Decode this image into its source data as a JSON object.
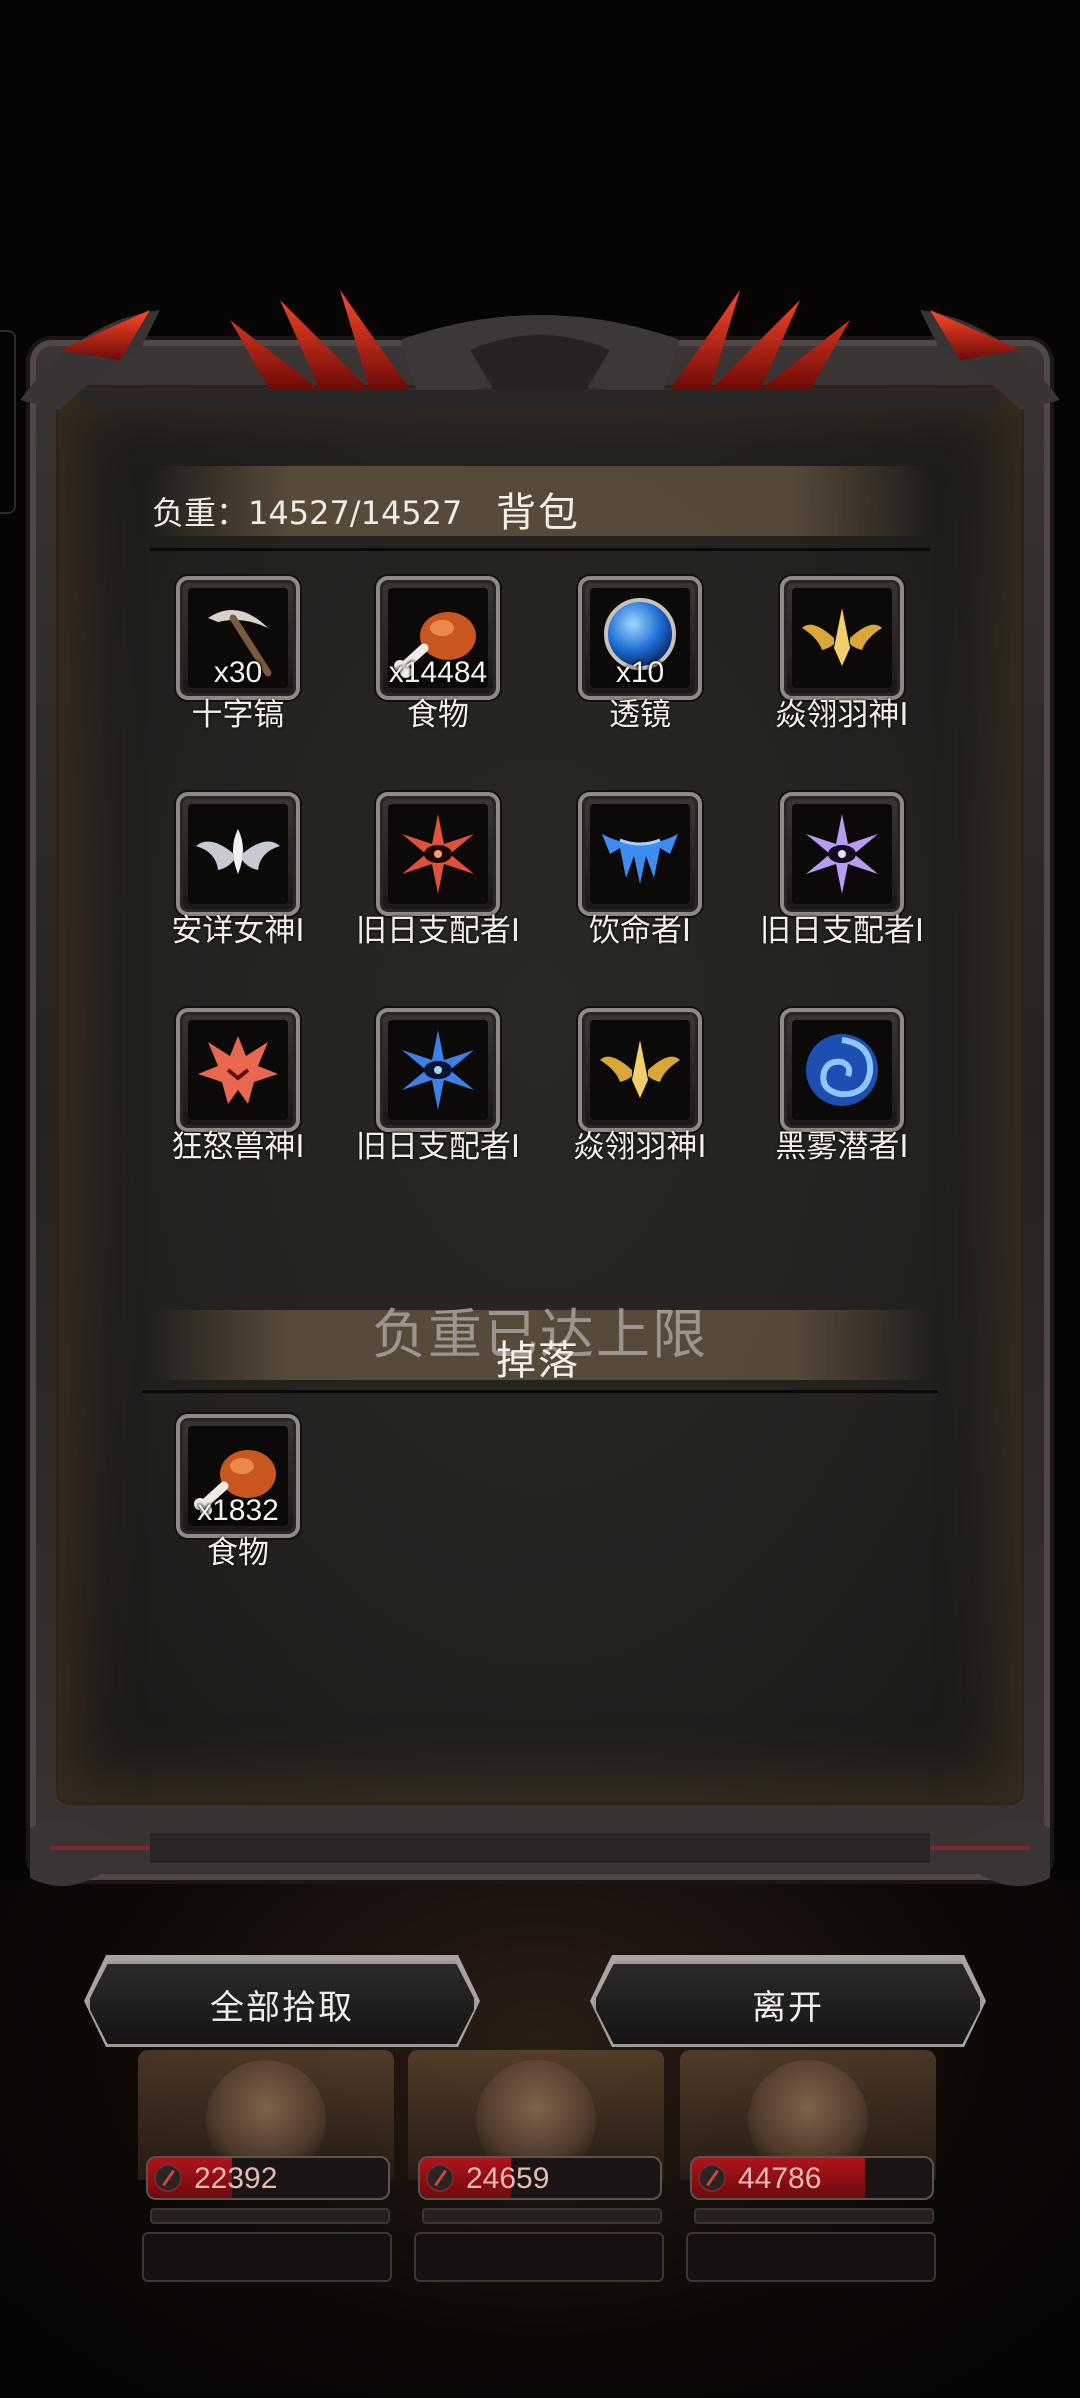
{
  "backpack": {
    "weight_text": "负重：14527/14527",
    "title": "背包",
    "items": [
      {
        "icon": "pickaxe-icon",
        "qty": "x30",
        "name": "十字镐"
      },
      {
        "icon": "food-icon",
        "qty": "x14484",
        "name": "食物"
      },
      {
        "icon": "lens-icon",
        "qty": "x10",
        "name": "透镜"
      },
      {
        "icon": "golden-wing-emblem-icon",
        "qty": "",
        "name": "焱翎羽神Ⅰ"
      },
      {
        "icon": "white-lotus-emblem-icon",
        "qty": "",
        "name": "安详女神Ⅰ"
      },
      {
        "icon": "red-eye-emblem-icon",
        "qty": "",
        "name": "旧日支配者Ⅰ"
      },
      {
        "icon": "blue-fang-emblem-icon",
        "qty": "",
        "name": "饮命者Ⅰ"
      },
      {
        "icon": "violet-eye-emblem-icon",
        "qty": "",
        "name": "旧日支配者Ⅰ"
      },
      {
        "icon": "red-beast-emblem-icon",
        "qty": "",
        "name": "狂怒兽神Ⅰ"
      },
      {
        "icon": "blue-eye-emblem-icon",
        "qty": "",
        "name": "旧日支配者Ⅰ"
      },
      {
        "icon": "golden-wing-emblem-icon",
        "qty": "",
        "name": "焱翎羽神Ⅰ"
      },
      {
        "icon": "blue-swirl-emblem-icon",
        "qty": "",
        "name": "黑雾潜者Ⅰ"
      }
    ]
  },
  "limit_message": "负重已达上限",
  "drops": {
    "title": "掉落",
    "items": [
      {
        "icon": "food-icon",
        "qty": "x1832",
        "name": "食物"
      }
    ]
  },
  "buttons": {
    "pickup_all": "全部拾取",
    "leave": "离开"
  },
  "heroes": [
    {
      "power": "22392",
      "power_fill": 0.35
    },
    {
      "power": "24659",
      "power_fill": 0.38
    },
    {
      "power": "44786",
      "power_fill": 0.72
    }
  ],
  "colors": {
    "accent_red": "#b0141a",
    "frame_grey": "#9d9896",
    "strip_brown": "#605040"
  }
}
